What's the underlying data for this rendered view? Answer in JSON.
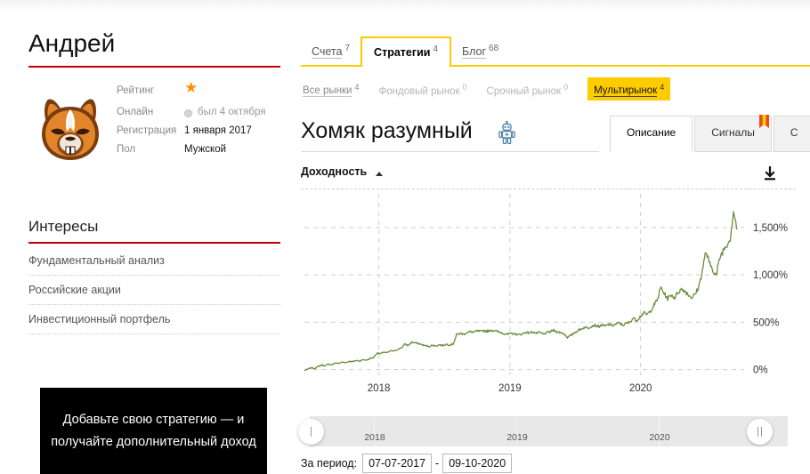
{
  "profile": {
    "name": "Андрей",
    "avatar_icon": "hamster-mascot-avatar",
    "info": [
      {
        "label": "Рейтинг",
        "value": "★",
        "type": "star"
      },
      {
        "label": "Онлайн",
        "value": "был 4 октября",
        "type": "status"
      },
      {
        "label": "Регистрация",
        "value": "1 января 2017",
        "type": "text"
      },
      {
        "label": "Пол",
        "value": "Мужской",
        "type": "text"
      }
    ],
    "interests_title": "Интересы",
    "interests": [
      "Фундаментальный анализ",
      "Российские акции",
      "Инвестиционный портфель"
    ]
  },
  "promo": {
    "text": "Добавьте свою стратегию — и получайте дополнительный  доход"
  },
  "tabs_primary": [
    {
      "label": "Счета",
      "count": "7",
      "active": false
    },
    {
      "label": "Стратегии",
      "count": "4",
      "active": true
    },
    {
      "label": "Блог",
      "count": "68",
      "active": false
    }
  ],
  "tabs_secondary": [
    {
      "label": "Все рынки",
      "count": "4",
      "style": "link"
    },
    {
      "label": "Фондовый рынок",
      "count": "0",
      "style": "muted"
    },
    {
      "label": "Срочный рынок",
      "count": "0",
      "style": "muted"
    },
    {
      "label": "Мультирынок",
      "count": "4",
      "style": "highlight"
    }
  ],
  "strategy": {
    "title": "Хомяк разумный",
    "badge_icon": "robot-icon"
  },
  "tabs_right": [
    {
      "label": "Описание",
      "active": true,
      "ribbon": false
    },
    {
      "label": "Сигналы",
      "active": false,
      "ribbon": true
    },
    {
      "label": "С",
      "active": false,
      "ribbon": false
    }
  ],
  "chart_panel": {
    "header_label": "Доходность",
    "sort_icon": "caret-up-icon",
    "download_icon": "download-icon"
  },
  "navigator": {
    "years": [
      "2018",
      "2019",
      "2020"
    ],
    "left_handle_icon": "navigator-handle-left",
    "right_handle_icon": "navigator-handle-right"
  },
  "period": {
    "label": "За период:",
    "from": "07-07-2017",
    "dash": "-",
    "to": "09-10-2020"
  },
  "colors": {
    "accent_yellow": "#ffcc00",
    "accent_red": "#c00000",
    "line_green": "#6b8e3e",
    "star_orange": "#ff9000"
  },
  "chart_data": {
    "type": "line",
    "title": "Доходность",
    "xlabel": "",
    "ylabel": "",
    "ylim": [
      -60,
      1800
    ],
    "xlim": [
      "2017-07-07",
      "2020-10-09"
    ],
    "grid": true,
    "legend": "none",
    "ytick_labels": [
      "0%",
      "500%",
      "1,000%",
      "1,500%"
    ],
    "ytick_values": [
      0,
      500,
      1000,
      1500
    ],
    "xtick_labels": [
      "2018",
      "2019",
      "2020"
    ],
    "series": [
      {
        "name": "Доходность",
        "color": "#6b8e3e",
        "x": [
          0.0,
          0.008,
          0.016,
          0.024,
          0.032,
          0.04,
          0.048,
          0.056,
          0.064,
          0.072,
          0.08,
          0.088,
          0.096,
          0.104,
          0.112,
          0.12,
          0.128,
          0.136,
          0.144,
          0.152,
          0.16,
          0.168,
          0.176,
          0.184,
          0.192,
          0.2,
          0.208,
          0.216,
          0.224,
          0.232,
          0.24,
          0.248,
          0.256,
          0.264,
          0.272,
          0.28,
          0.288,
          0.296,
          0.304,
          0.312,
          0.32,
          0.328,
          0.336,
          0.344,
          0.352,
          0.36,
          0.368,
          0.376,
          0.384,
          0.392,
          0.4,
          0.408,
          0.416,
          0.424,
          0.432,
          0.44,
          0.448,
          0.456,
          0.464,
          0.472,
          0.48,
          0.488,
          0.496,
          0.504,
          0.512,
          0.52,
          0.528,
          0.536,
          0.544,
          0.552,
          0.56,
          0.568,
          0.576,
          0.584,
          0.592,
          0.6,
          0.608,
          0.616,
          0.624,
          0.632,
          0.64,
          0.648,
          0.656,
          0.664,
          0.672,
          0.68,
          0.688,
          0.696,
          0.704,
          0.712,
          0.72,
          0.728,
          0.736,
          0.744,
          0.752,
          0.76,
          0.768,
          0.776,
          0.784,
          0.792,
          0.8,
          0.808,
          0.816,
          0.824,
          0.832,
          0.84,
          0.848,
          0.856,
          0.864,
          0.872,
          0.88,
          0.888,
          0.896,
          0.904,
          0.912,
          0.92,
          0.928,
          0.936,
          0.944,
          0.952,
          0.96,
          0.968,
          0.976,
          0.984,
          0.992,
          1.0
        ],
        "values": [
          -10,
          5,
          20,
          12,
          35,
          48,
          40,
          58,
          52,
          70,
          66,
          80,
          74,
          88,
          84,
          96,
          92,
          105,
          100,
          118,
          128,
          175,
          168,
          185,
          178,
          200,
          196,
          215,
          230,
          268,
          255,
          290,
          282,
          275,
          262,
          252,
          245,
          258,
          250,
          262,
          255,
          268,
          260,
          272,
          370,
          382,
          375,
          392,
          400,
          395,
          408,
          402,
          412,
          405,
          418,
          410,
          400,
          390,
          378,
          372,
          382,
          375,
          368,
          378,
          395,
          388,
          400,
          382,
          392,
          375,
          388,
          400,
          415,
          400,
          392,
          380,
          340,
          360,
          390,
          412,
          430,
          448,
          440,
          462,
          470,
          455,
          470,
          460,
          478,
          466,
          480,
          492,
          470,
          488,
          500,
          545,
          520,
          560,
          600,
          580,
          620,
          680,
          740,
          870,
          800,
          750,
          790,
          760,
          820,
          850,
          830,
          790,
          760,
          800,
          880,
          1050,
          1250,
          1120,
          1060,
          990,
          1180,
          1260,
          1320,
          1380,
          1680,
          1480
        ]
      }
    ]
  }
}
